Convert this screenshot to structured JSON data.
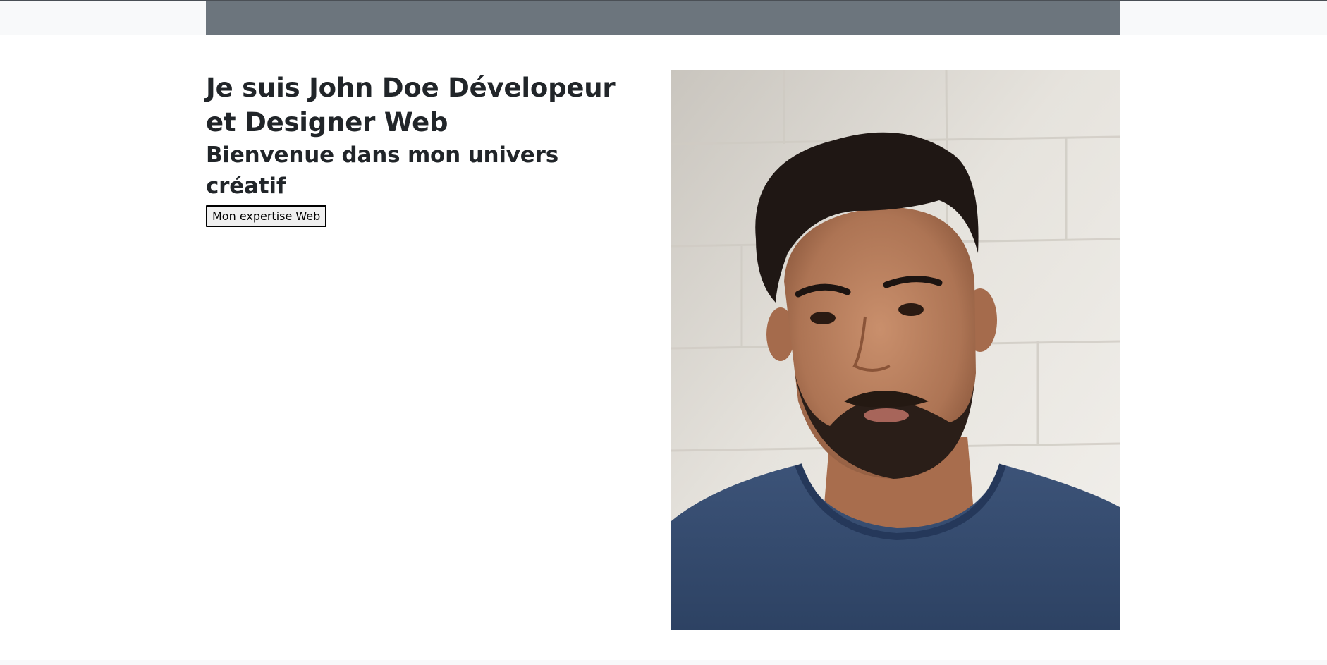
{
  "hero": {
    "title": "Je suis John Doe Dévelopeur et Designer Web",
    "subtitle": "Bienvenue dans mon univers créatif",
    "button_label": "Mon expertise Web"
  },
  "colors": {
    "navbar": "#6c757d",
    "page_background": "#ffffff",
    "strip_background": "#f8f9fa",
    "text": "#212529"
  }
}
